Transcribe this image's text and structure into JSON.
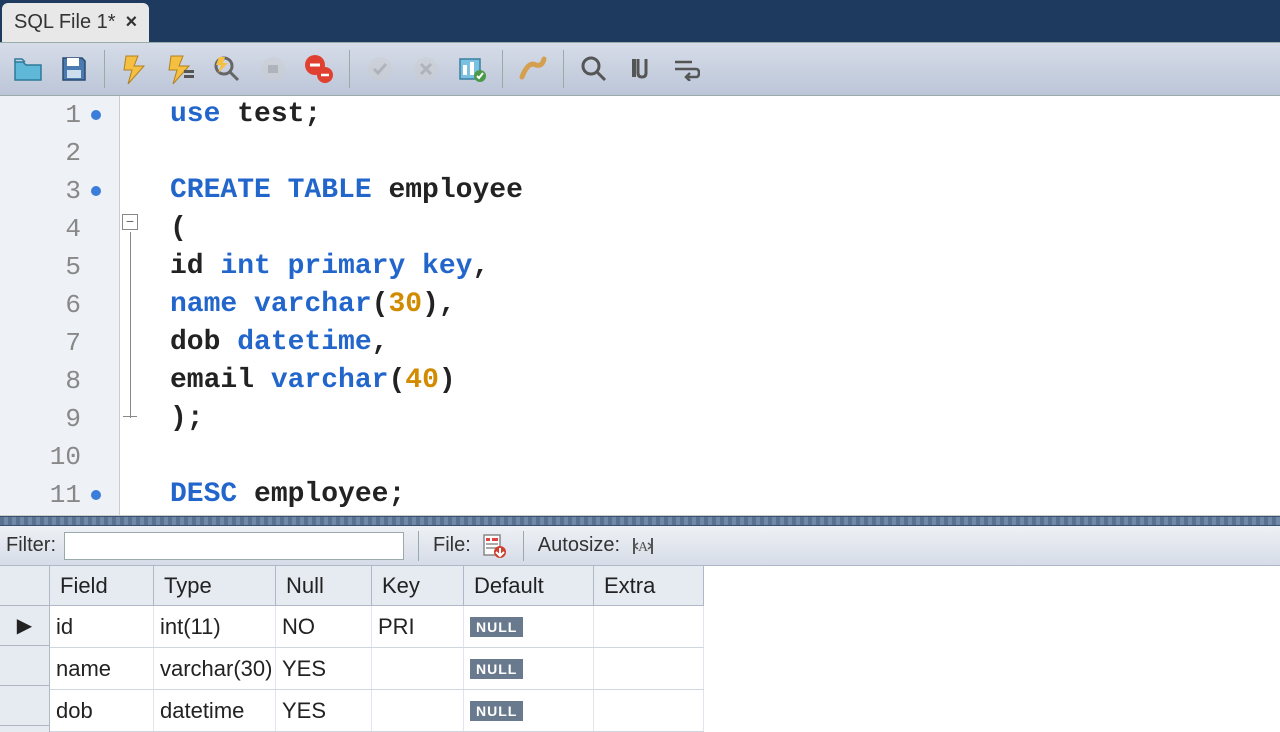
{
  "tab": {
    "title": "SQL File 1*"
  },
  "code": {
    "lines": [
      {
        "n": "1",
        "dot": true
      },
      {
        "n": "2",
        "dot": false
      },
      {
        "n": "3",
        "dot": true
      },
      {
        "n": "4",
        "dot": false
      },
      {
        "n": "5",
        "dot": false
      },
      {
        "n": "6",
        "dot": false
      },
      {
        "n": "7",
        "dot": false
      },
      {
        "n": "8",
        "dot": false
      },
      {
        "n": "9",
        "dot": false
      },
      {
        "n": "10",
        "dot": false
      },
      {
        "n": "11",
        "dot": true
      }
    ],
    "l1_kw": "use",
    "l1_rest": " test;",
    "l3_kw": "CREATE TABLE",
    "l3_rest": " employee",
    "l4": "(",
    "l5_pre": "id ",
    "l5_kw": "int primary key",
    "l5_post": ",",
    "l6_kw1": "name",
    "l6_sp": " ",
    "l6_kw2": "varchar",
    "l6_p1": "(",
    "l6_num": "30",
    "l6_p2": "),",
    "l7_pre": "dob ",
    "l7_kw": "datetime",
    "l7_post": ",",
    "l8_pre": "email ",
    "l8_kw": "varchar",
    "l8_p1": "(",
    "l8_num": "40",
    "l8_p2": ")",
    "l9": ");",
    "l11_kw": "DESC",
    "l11_rest": " employee;"
  },
  "results": {
    "filter_label": "Filter:",
    "file_label": "File:",
    "autosize_label": "Autosize:",
    "headers": {
      "field": "Field",
      "type": "Type",
      "null": "Null",
      "key": "Key",
      "default": "Default",
      "extra": "Extra"
    },
    "null_badge": "NULL",
    "rows": [
      {
        "field": "id",
        "type": "int(11)",
        "null": "NO",
        "key": "PRI",
        "default": "NULL",
        "extra": ""
      },
      {
        "field": "name",
        "type": "varchar(30)",
        "null": "YES",
        "key": "",
        "default": "NULL",
        "extra": ""
      },
      {
        "field": "dob",
        "type": "datetime",
        "null": "YES",
        "key": "",
        "default": "NULL",
        "extra": ""
      }
    ]
  }
}
